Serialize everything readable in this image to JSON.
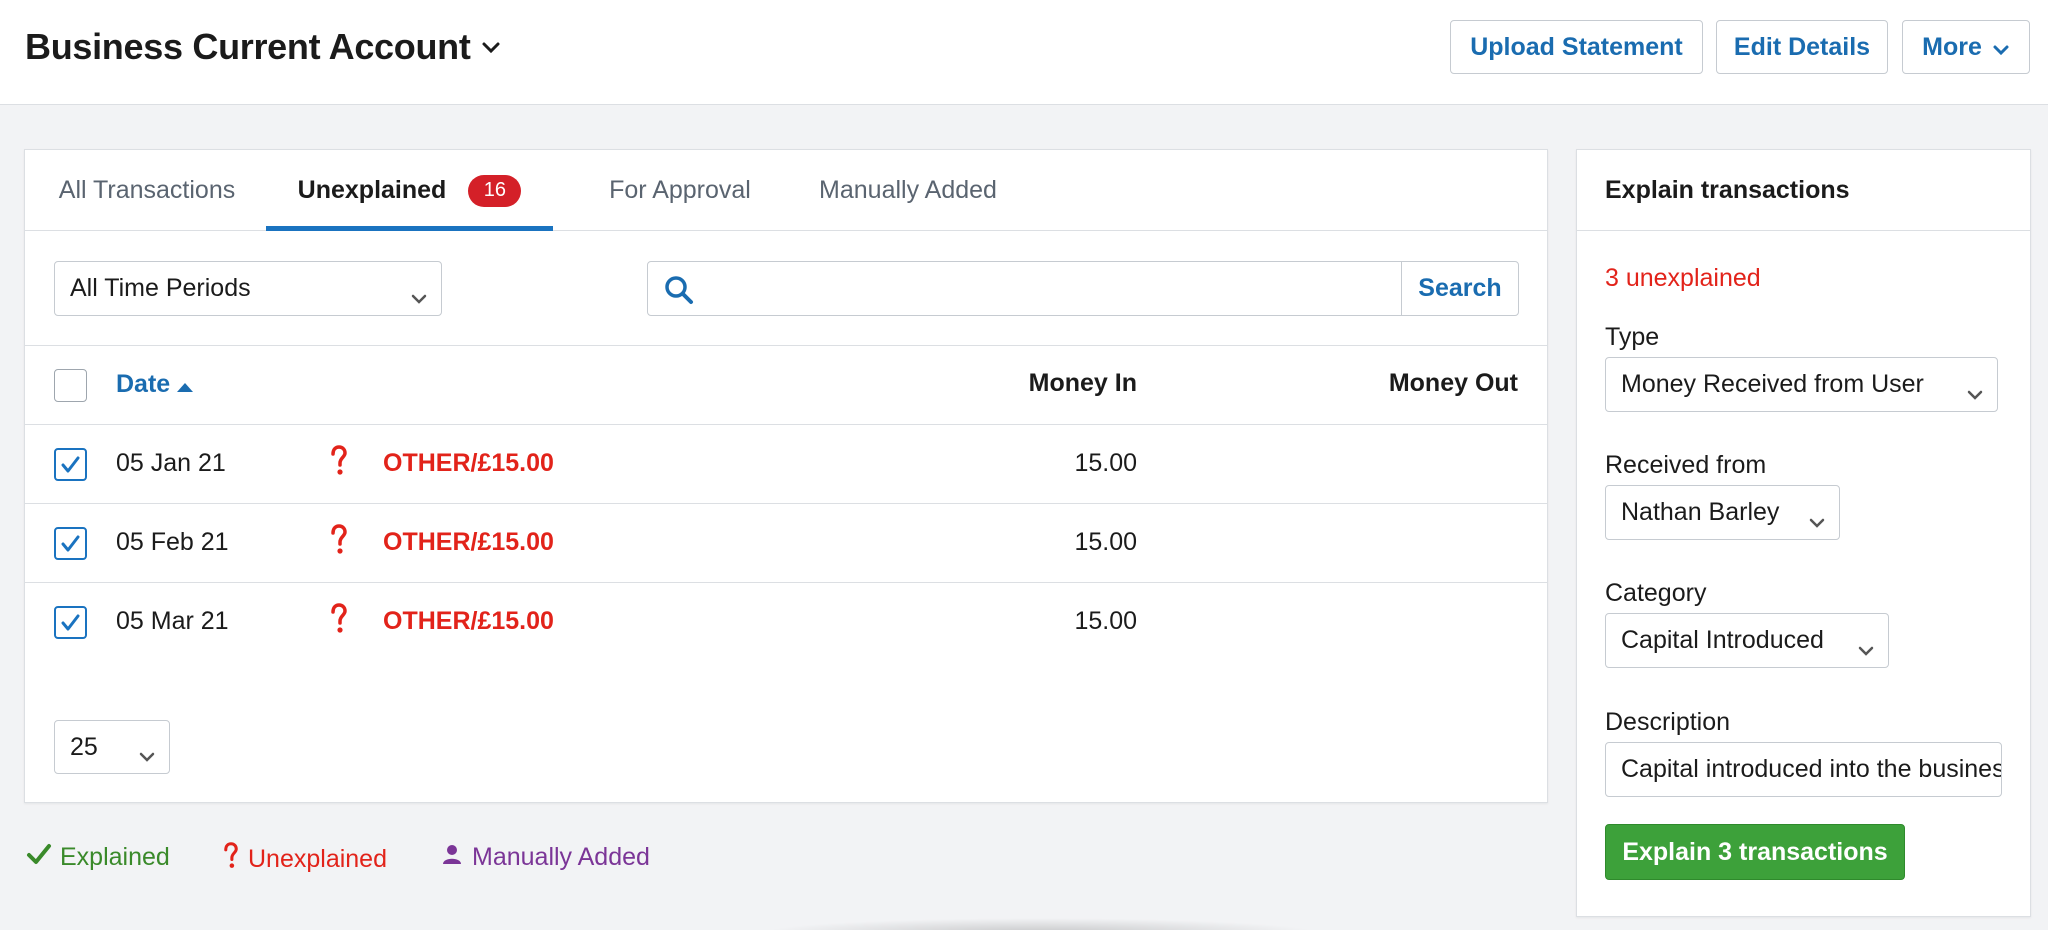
{
  "header": {
    "account_title": "Business Current Account",
    "upload_label": "Upload Statement",
    "edit_label": "Edit Details",
    "more_label": "More"
  },
  "tabs": [
    {
      "label": "All Transactions"
    },
    {
      "label": "Unexplained",
      "badge": "16"
    },
    {
      "label": "For Approval"
    },
    {
      "label": "Manually Added"
    }
  ],
  "filters": {
    "period_value": "All Time Periods",
    "search_value": "",
    "search_button": "Search"
  },
  "table": {
    "col_date": "Date",
    "col_money_in": "Money In",
    "col_money_out": "Money Out",
    "rows": [
      {
        "date": "05 Jan 21",
        "description": "OTHER/£15.00",
        "money_in": "15.00",
        "money_out": "",
        "checked": true
      },
      {
        "date": "05 Feb 21",
        "description": "OTHER/£15.00",
        "money_in": "15.00",
        "money_out": "",
        "checked": true
      },
      {
        "date": "05 Mar 21",
        "description": "OTHER/£15.00",
        "money_in": "15.00",
        "money_out": "",
        "checked": true
      }
    ],
    "per_page": "25"
  },
  "legend": {
    "explained": "Explained",
    "unexplained": "Unexplained",
    "manual": "Manually Added"
  },
  "side_panel": {
    "title": "Explain transactions",
    "unexplained_count": "3 unexplained",
    "type_label": "Type",
    "type_value": "Money Received from User",
    "received_label": "Received from",
    "received_value": "Nathan Barley",
    "category_label": "Category",
    "category_value": "Capital Introduced",
    "description_label": "Description",
    "description_value": "Capital introduced into the business",
    "explain_button": "Explain 3 transactions"
  },
  "colors": {
    "link_blue": "#1a6cb0",
    "tab_underline": "#1a73c0",
    "badge_red": "#d42028",
    "unexplained_red": "#e2231a",
    "explained_green": "#3a8a2a",
    "manual_purple": "#7b3597",
    "button_green": "#3da13a"
  }
}
